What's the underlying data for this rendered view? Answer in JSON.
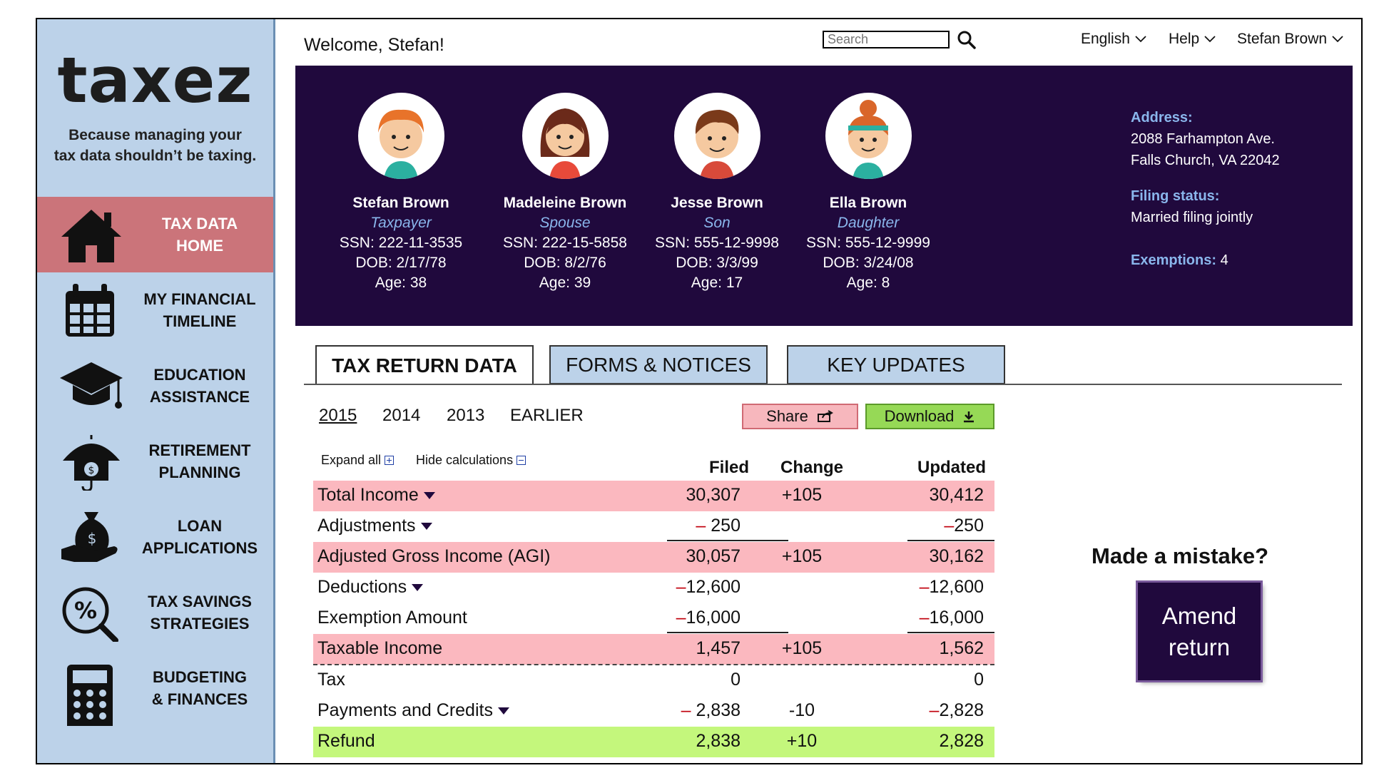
{
  "brand": {
    "logo": "taxez",
    "tagline_line1": "Because managing your",
    "tagline_line2": "tax data shouldn’t be taxing."
  },
  "sidebar": {
    "items": [
      {
        "line1": "TAX DATA",
        "line2": "HOME",
        "icon": "home-icon",
        "active": true
      },
      {
        "line1": "MY FINANCIAL",
        "line2": "TIMELINE",
        "icon": "calendar-icon"
      },
      {
        "line1": "EDUCATION",
        "line2": "ASSISTANCE",
        "icon": "graduation-cap-icon"
      },
      {
        "line1": "RETIREMENT",
        "line2": "PLANNING",
        "icon": "umbrella-money-icon"
      },
      {
        "line1": "LOAN",
        "line2": "APPLICATIONS",
        "icon": "money-bag-hand-icon"
      },
      {
        "line1": "TAX SAVINGS",
        "line2": "STRATEGIES",
        "icon": "percent-magnifier-icon"
      },
      {
        "line1": "BUDGETING",
        "line2": "& FINANCES",
        "icon": "calculator-icon"
      }
    ],
    "active_color": "#cb747a",
    "background": "#bcd2e9"
  },
  "header": {
    "welcome": "Welcome, Stefan!",
    "search_placeholder": "Search",
    "language": "English",
    "help": "Help",
    "user": "Stefan Brown"
  },
  "family": {
    "members": [
      {
        "name": "Stefan Brown",
        "role": "Taxpayer",
        "ssn": "SSN: 222-11-3535",
        "dob": "DOB: 2/17/78",
        "age": "Age: 38"
      },
      {
        "name": "Madeleine Brown",
        "role": "Spouse",
        "ssn": "SSN: 222-15-5858",
        "dob": "DOB: 8/2/76",
        "age": "Age: 39"
      },
      {
        "name": "Jesse Brown",
        "role": "Son",
        "ssn": "SSN: 555-12-9998",
        "dob": "DOB: 3/3/99",
        "age": "Age: 17"
      },
      {
        "name": "Ella Brown",
        "role": "Daughter",
        "ssn": "SSN: 555-12-9999",
        "dob": "DOB: 3/24/08",
        "age": "Age: 8"
      }
    ],
    "address_label": "Address:",
    "address_line1": "2088 Farhampton Ave.",
    "address_line2": "Falls Church, VA 22042",
    "filing_label": "Filing status:",
    "filing_value": "Married filing jointly",
    "exemptions_label": "Exemptions:",
    "exemptions_value": "4",
    "banner_color": "#20093d"
  },
  "tabs": [
    "TAX RETURN DATA",
    "FORMS & NOTICES",
    "KEY UPDATES"
  ],
  "years": [
    "2015",
    "2014",
    "2013",
    "EARLIER"
  ],
  "actions": {
    "share": "Share",
    "download": "Download"
  },
  "table": {
    "expand_all": "Expand all",
    "hide_calculations": "Hide calculations",
    "columns": [
      "Filed",
      "Change",
      "Updated"
    ],
    "rows": [
      {
        "label": "Total Income",
        "filed": "30,307",
        "change": "+105",
        "updated": "30,412"
      },
      {
        "label": "Adjustments",
        "filed": "250",
        "change": "",
        "updated": "250"
      },
      {
        "label": "Adjusted Gross Income (AGI)",
        "filed": "30,057",
        "change": "+105",
        "updated": "30,162"
      },
      {
        "label": "Deductions",
        "filed": "12,600",
        "change": "",
        "updated": "12,600"
      },
      {
        "label": "Exemption Amount",
        "filed": "16,000",
        "change": "",
        "updated": "16,000"
      },
      {
        "label": "Taxable Income",
        "filed": "1,457",
        "change": "+105",
        "updated": "1,562"
      },
      {
        "label": "Tax",
        "filed": "0",
        "change": "",
        "updated": "0"
      },
      {
        "label": "Payments and Credits",
        "filed": "2,838",
        "change": "-10",
        "updated": "2,828"
      },
      {
        "label": "Refund",
        "filed": "2,838",
        "change": "+10",
        "updated": "2,828"
      }
    ],
    "minus_sign": "–"
  },
  "mistake": {
    "title": "Made a mistake?",
    "amend_line1": "Amend",
    "amend_line2": "return"
  }
}
